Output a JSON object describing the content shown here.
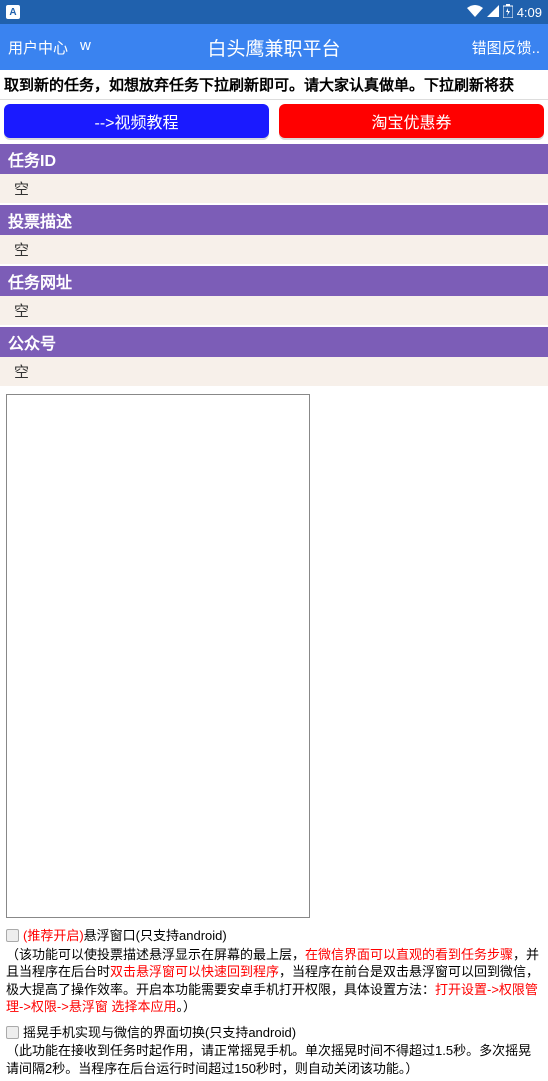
{
  "statusBar": {
    "leftIcon": "A",
    "time": "4:09"
  },
  "appBar": {
    "userCenter": "用户中心",
    "w": "w",
    "title": "白头鹰兼职平台",
    "feedback": "错图反馈.."
  },
  "notice": "取到新的任务，如想放弃任务下拉刷新即可。请大家认真做单。下拉刷新将获",
  "buttons": {
    "video": "-->视频教程",
    "coupon": "淘宝优惠券"
  },
  "sections": {
    "taskId": {
      "label": "任务ID",
      "value": "空"
    },
    "voteDesc": {
      "label": "投票描述",
      "value": "空"
    },
    "taskUrl": {
      "label": "任务网址",
      "value": "空"
    },
    "pubAccount": {
      "label": "公众号",
      "value": "空"
    }
  },
  "option1": {
    "recommend": "(推荐开启)",
    "label": "悬浮窗口(只支持android)",
    "desc1": "（该功能可以使投票描述悬浮显示在屏幕的最上层，",
    "desc1red": "在微信界面可以直观的看到任务步骤",
    "desc2": "，并且当程序在后台时",
    "desc2red": "双击悬浮窗可以快速回到程序",
    "desc3": "，当程序在前台是双击悬浮窗可以回到微信，极大提高了操作效率。开启本功能需要安卓手机打开权限，具体设置方法：",
    "desc3red": "打开设置->权限管理->权限->悬浮窗 选择本应用",
    "desc4": "。）"
  },
  "option2": {
    "label": "摇晃手机实现与微信的界面切换(只支持android)",
    "desc": "（此功能在接收到任务时起作用，请正常摇晃手机。单次摇晃时间不得超过1.5秒。多次摇晃请间隔2秒。当程序在后台运行时间超过150秒时，则自动关闭该功能。）"
  }
}
